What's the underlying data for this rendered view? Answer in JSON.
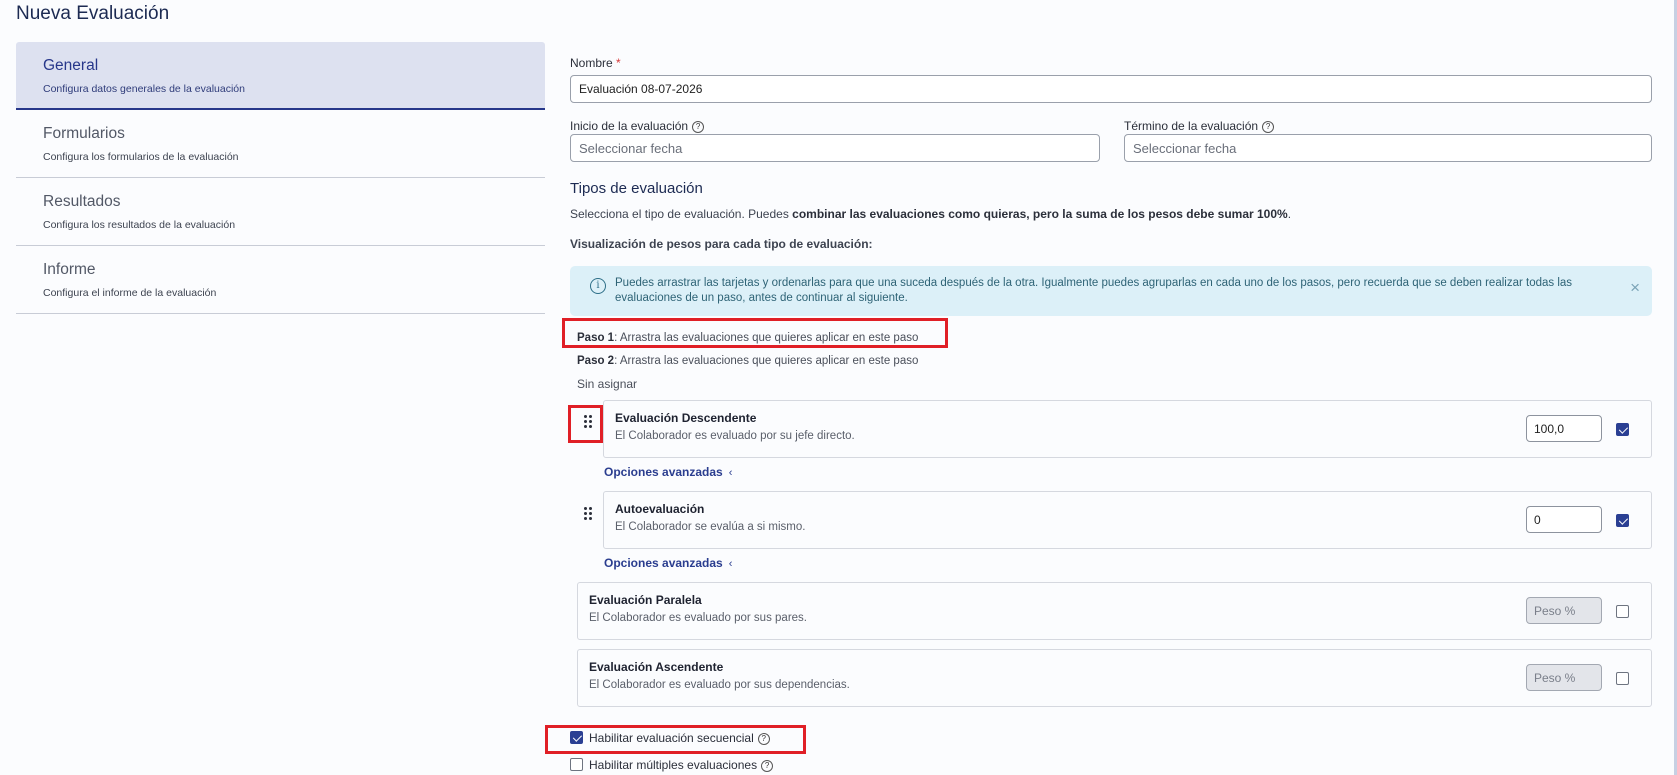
{
  "page": {
    "title": "Nueva Evaluación"
  },
  "sidebar": {
    "items": [
      {
        "label": "General",
        "desc": "Configura datos generales de la evaluación",
        "active": true
      },
      {
        "label": "Formularios",
        "desc": "Configura los formularios de la evaluación",
        "active": false
      },
      {
        "label": "Resultados",
        "desc": "Configura los resultados de la evaluación",
        "active": false
      },
      {
        "label": "Informe",
        "desc": "Configura el informe de la evaluación",
        "active": false
      }
    ]
  },
  "form": {
    "name_label": "Nombre",
    "required_mark": "*",
    "name_value": "Evaluación 08-07-2026",
    "start_label": "Inicio de la evaluación",
    "start_placeholder": "Seleccionar fecha",
    "end_label": "Término de la evaluación",
    "end_placeholder": "Seleccionar fecha",
    "help_glyph": "?"
  },
  "types": {
    "title": "Tipos de evaluación",
    "desc_pre": "Selecciona el tipo de evaluación. Puedes ",
    "desc_bold": "combinar las evaluaciones como quieras, pero la suma de los pesos debe sumar 100%",
    "desc_post": ".",
    "viz_label": "Visualización de pesos para cada tipo de evaluación:",
    "alert_text": "Puedes arrastrar las tarjetas y ordenarlas para que una suceda después de la otra. Igualmente puedes agruparlas en cada uno de los pasos, pero recuerda que se deben realizar todas las evaluaciones de un paso, antes de continuar al siguiente.",
    "alert_icon": "i",
    "alert_close": "×",
    "steps": [
      {
        "prefix": "Paso 1",
        "text": ": Arrastra las evaluaciones que quieres aplicar en este paso"
      },
      {
        "prefix": "Paso 2",
        "text": ": Arrastra las evaluaciones que quieres aplicar en este paso"
      }
    ],
    "unassigned_label": "Sin asignar",
    "advanced_label": "Opciones avanzadas",
    "advanced_chevron": "‹",
    "cards": [
      {
        "title": "Evaluación Descendente",
        "desc": "El Colaborador es evaluado por su jefe directo.",
        "weight": "100,0",
        "checked": true
      },
      {
        "title": "Autoevaluación",
        "desc": "El Colaborador se evalúa a si mismo.",
        "weight": "0",
        "checked": true
      },
      {
        "title": "Evaluación Paralela",
        "desc": "El Colaborador es evaluado por sus pares.",
        "weight_placeholder": "Peso %",
        "checked": false
      },
      {
        "title": "Evaluación Ascendente",
        "desc": "El Colaborador es evaluado por sus dependencias.",
        "weight_placeholder": "Peso %",
        "checked": false
      }
    ]
  },
  "options": {
    "sequential_label": "Habilitar evaluación secuencial",
    "sequential_checked": true,
    "multiple_label": "Habilitar múltiples evaluaciones",
    "multiple_checked": false
  },
  "colors": {
    "accent": "#2a3f93",
    "highlight": "#e01f26",
    "alert_bg": "#dcf0f8"
  }
}
